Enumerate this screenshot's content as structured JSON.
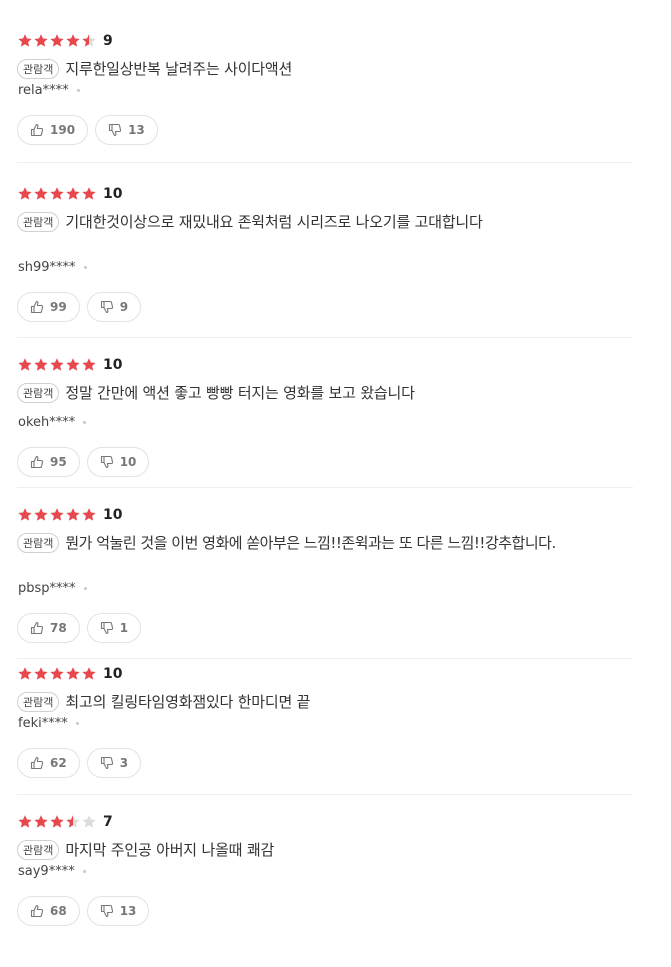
{
  "colors": {
    "star_filled": "#e8484d",
    "star_empty": "#dcdcdc",
    "divider": "#eeeeee"
  },
  "icons": {
    "star": "star-icon",
    "like": "thumbs-up-icon",
    "dislike": "thumbs-down-icon"
  },
  "reviews": [
    {
      "rating": 9,
      "stars_filled": 4.5,
      "score": "9",
      "badge": "관람객",
      "text": "지루한일상반복 날려주는 사이다액션",
      "user": "rela****",
      "likes": "190",
      "dislikes": "13"
    },
    {
      "rating": 10,
      "stars_filled": 5,
      "score": "10",
      "badge": "관람객",
      "text": "기대한것이상으로 재밌내요  존윅처럼 시리즈로 나오기를 고대합니다",
      "user": "sh99****",
      "likes": "99",
      "dislikes": "9"
    },
    {
      "rating": 10,
      "stars_filled": 5,
      "score": "10",
      "badge": "관람객",
      "text": "정말 간만에 액션 좋고 빵빵 터지는 영화를 보고 왔습니다",
      "user": "okeh****",
      "likes": "95",
      "dislikes": "10"
    },
    {
      "rating": 10,
      "stars_filled": 5,
      "score": "10",
      "badge": "관람객",
      "text": "뭔가 억눌린 것을 이번 영화에 쏟아부은 느낌!!존윅과는 또 다른 느낌!!강추합니다.",
      "user": "pbsp****",
      "likes": "78",
      "dislikes": "1"
    },
    {
      "rating": 10,
      "stars_filled": 5,
      "score": "10",
      "badge": "관람객",
      "text": "최고의 킬링타임영화잼있다 한마디면 끝",
      "user": "feki****",
      "likes": "62",
      "dislikes": "3"
    },
    {
      "rating": 7,
      "stars_filled": 3.5,
      "score": "7",
      "badge": "관람객",
      "text": "마지막 주인공 아버지 나올때 쾌감",
      "user": "say9****",
      "likes": "68",
      "dislikes": "13"
    }
  ]
}
